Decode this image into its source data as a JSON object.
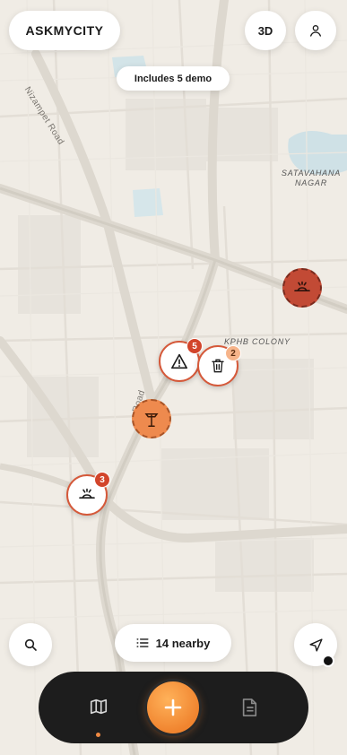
{
  "header": {
    "brand": "ASKMYCITY",
    "view_toggle": "3D",
    "user_icon": "user-icon"
  },
  "banner": {
    "demo_text": "Includes 5 demo"
  },
  "map": {
    "road_labels": {
      "nizampet": "Nizampet Road",
      "lower_road": "Road"
    },
    "area_labels": {
      "satavahana": [
        "SATAVAHANA",
        "NAGAR"
      ],
      "kphb": "KPHB COLONY"
    },
    "colors": {
      "marker_border": "#d5593a",
      "badge_red": "#d2452b",
      "badge_peach": "#f6b48a",
      "accent": "#f0842f"
    },
    "markers": [
      {
        "icon": "pothole-icon",
        "style": "dark",
        "count": ""
      },
      {
        "icon": "warning-icon",
        "style": "white",
        "count": "5"
      },
      {
        "icon": "trash-icon",
        "style": "white",
        "count": "2"
      },
      {
        "icon": "streetlight-icon",
        "style": "orange",
        "count": ""
      },
      {
        "icon": "pothole-icon",
        "style": "white",
        "count": "3"
      }
    ]
  },
  "controls": {
    "search_icon": "search-icon",
    "nearby_label": "14 nearby",
    "nearby_icon": "list-icon",
    "locate_icon": "navigation-icon"
  },
  "tabbar": {
    "map_icon": "map-icon",
    "add_icon": "plus-icon",
    "reports_icon": "document-icon"
  }
}
